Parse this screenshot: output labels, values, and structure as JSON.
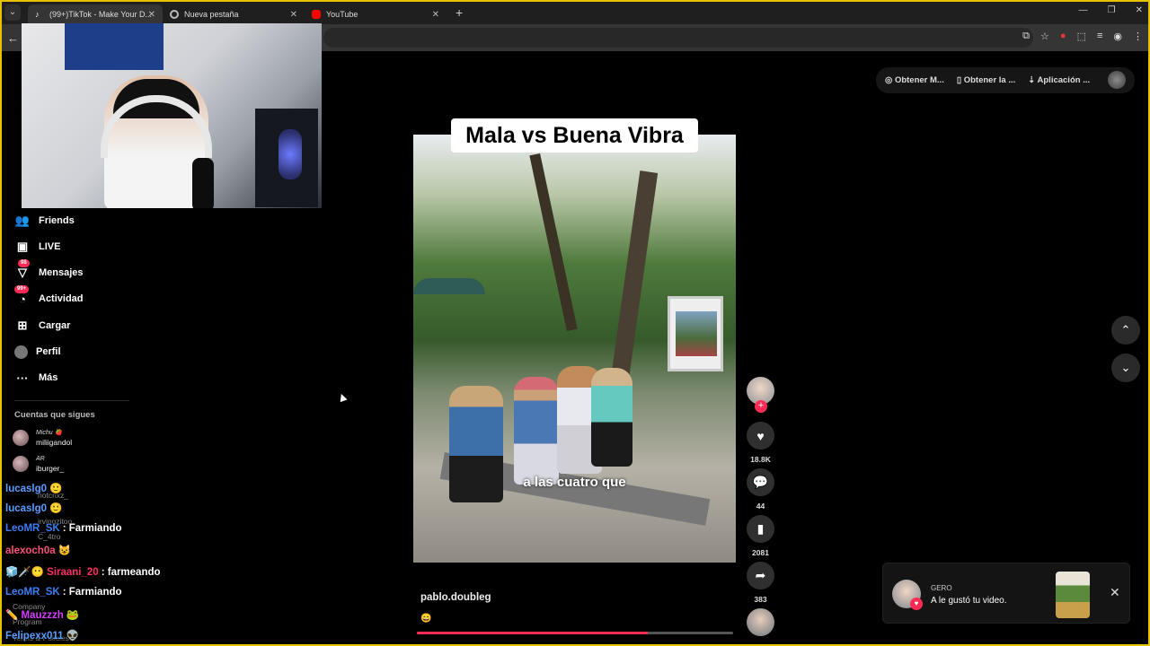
{
  "browser": {
    "tabs": [
      {
        "label": "(99+)TikTok - Make Your D...",
        "active": true
      },
      {
        "label": "Nueva pestaña",
        "active": false
      },
      {
        "label": "YouTube",
        "active": false
      }
    ],
    "new_tab": "+",
    "window_controls": [
      "—",
      "❐",
      "✕"
    ]
  },
  "sidebar": {
    "nav": [
      {
        "label": "Friends",
        "icon": "friends-icon",
        "badge": ""
      },
      {
        "label": "LIVE",
        "icon": "live-icon",
        "badge": ""
      },
      {
        "label": "Mensajes",
        "icon": "messages-icon",
        "badge": "98"
      },
      {
        "label": "Actividad",
        "icon": "activity-icon",
        "badge": "99+"
      },
      {
        "label": "Cargar",
        "icon": "upload-icon",
        "badge": ""
      },
      {
        "label": "Perfil",
        "icon": "profile-icon",
        "badge": ""
      },
      {
        "label": "Más",
        "icon": "more-icon",
        "badge": ""
      }
    ],
    "following_title": "Cuentas que sigues",
    "following": [
      {
        "display": "Michu 🍓",
        "handle": "miliigandol"
      },
      {
        "display": "AR",
        "handle": "iburger_"
      },
      {
        "display": "",
        "handle": "notcrixz_"
      },
      {
        "display": "",
        "handle": "irvingzitoo"
      },
      {
        "display": "",
        "handle": "C_4tro"
      }
    ],
    "footer_ghost": [
      "Company",
      "Program",
      "Terms & Policies"
    ]
  },
  "chat": [
    {
      "user": "lucaslg0",
      "color": "#5b9cff",
      "msg": "🙂"
    },
    {
      "user": "lucaslg0",
      "color": "#5b9cff",
      "msg": "🙂"
    },
    {
      "user": "LeoMR_SK",
      "color": "#3b7df5",
      "msg": "Farmiando"
    },
    {
      "user": "alexoch0a",
      "color": "#ff4d7a",
      "msg": "😺"
    },
    {
      "user": "🧊🗡️😶 Siraani_20",
      "color": "#ff2e63",
      "msg": "farmeando"
    },
    {
      "user": "LeoMR_SK",
      "color": "#3b7df5",
      "msg": "Farmiando"
    },
    {
      "user": "✏️ Mauzzzh",
      "color": "#d63cff",
      "msg": "🐸"
    },
    {
      "user": "Felipexx011",
      "color": "#5b9cff",
      "msg": "👽"
    }
  ],
  "video": {
    "title_overlay": "Mala vs Buena Vibra",
    "caption": "a las cuatro que",
    "author": "pablo.doubleg",
    "author_emoji": "😄",
    "progress": 0.73
  },
  "actions": {
    "likes": "18.8K",
    "comments": "44",
    "saves": "2081",
    "shares": "383"
  },
  "topbar": {
    "items": [
      "Obtener M...",
      "Obtener la ...",
      "Aplicación ..."
    ]
  },
  "notification": {
    "user": "GERO",
    "message": "A le gustó tu video."
  },
  "colors": {
    "accent": "#fe2c55",
    "frame": "#e6c200"
  }
}
